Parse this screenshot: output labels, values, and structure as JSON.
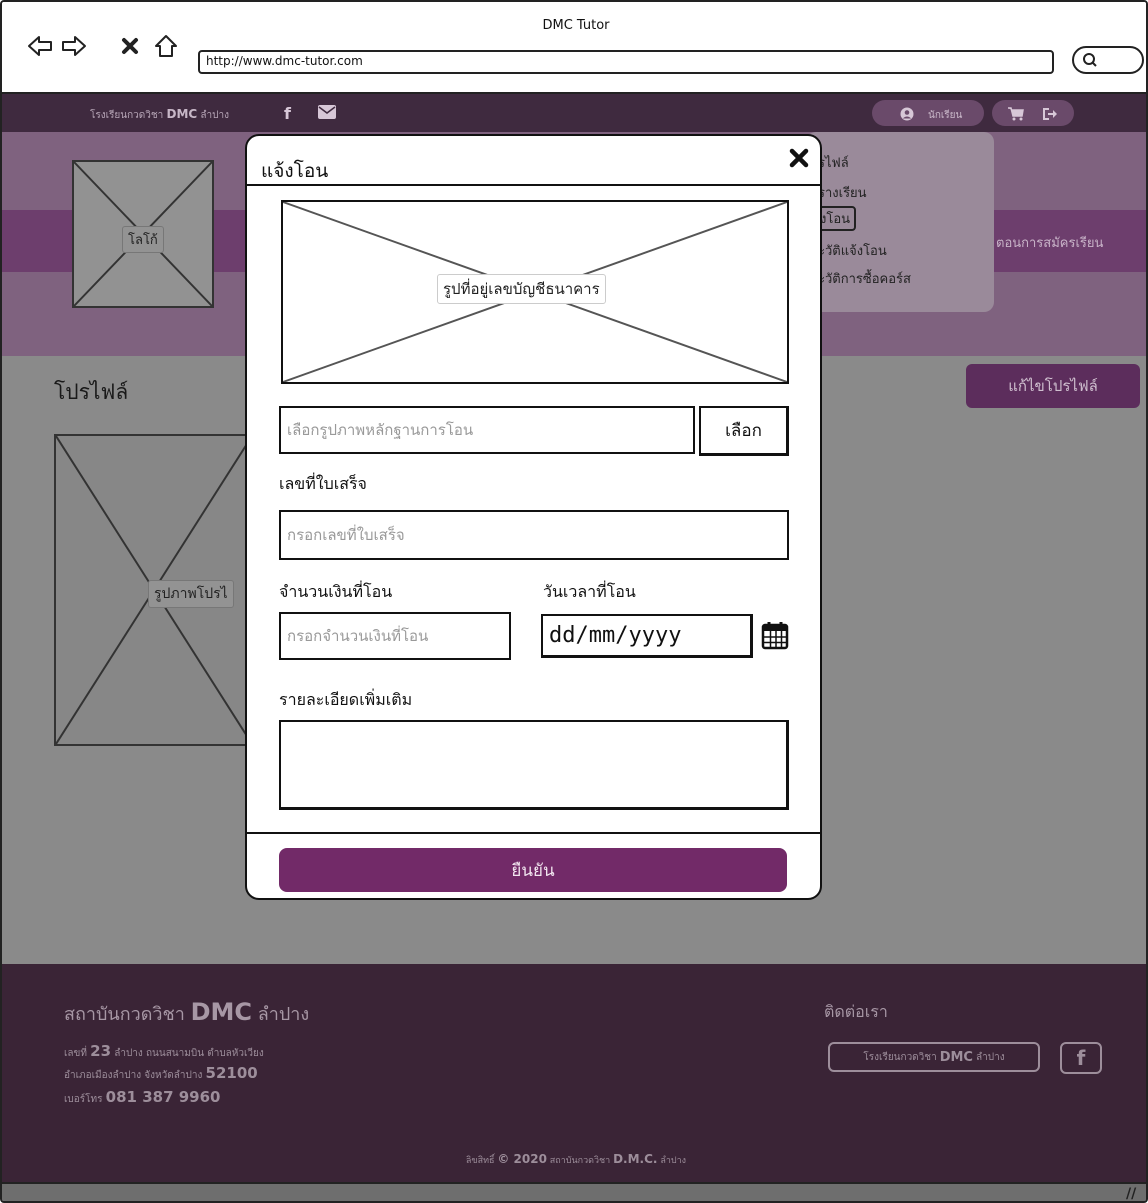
{
  "browser": {
    "window_title": "DMC Tutor",
    "url": "http://www.dmc-tutor.com"
  },
  "topbar": {
    "school_prefix": "โรงเรียนกวดวิชา ",
    "school_brand": "DMC",
    "school_suffix": " ลำปาง",
    "student_label": "นักเรียน"
  },
  "header": {
    "logo_label": "โลโก้"
  },
  "user_menu": {
    "items": [
      "รไฟล์",
      "รางเรียน",
      "งโอน",
      "ะวัติแจ้งโอน",
      "ะวัติการซื้อคอร์ส"
    ]
  },
  "nav": {
    "enroll_label": "ตอนการสมัครเรียน"
  },
  "profile": {
    "title": "โปรไฟล์",
    "edit_button": "แก้ไขโปรไฟล์",
    "photo_label": "รูปภาพโปรไ"
  },
  "modal": {
    "title": "แจ้งโอน",
    "bank_image_label": "รูปที่อยู่เลขบัญชีธนาคาร",
    "file_placeholder": "เลือกรูปภาพหลักฐานการโอน",
    "choose_button": "เลือก",
    "receipt_label": "เลขที่ใบเสร็จ",
    "receipt_placeholder": "กรอกเลขที่ใบเสร็จ",
    "amount_label": "จำนวนเงินที่โอน",
    "amount_placeholder": "กรอกจำนวนเงินที่โอน",
    "datetime_label": "วันเวลาที่โอน",
    "date_value": "dd/mm/yyyy",
    "details_label": "รายละเอียดเพิ่มเติม",
    "submit_button": "ยืนยัน"
  },
  "footer": {
    "title_prefix": "สถาบันกวดวิชา ",
    "title_brand": "DMC",
    "title_suffix": " ลำปาง",
    "addr1_a": "เลขที่ ",
    "addr1_num": "23",
    "addr1_b": " ลำปาง ถนนสนามบิน ตำบลหัวเวียง",
    "addr2_a": "อำเภอเมืองลำปาง จังหวัดลำปาง ",
    "addr2_num": "52100",
    "phone_a": "เบอร์โทร ",
    "phone_num": "081 387 9960",
    "contact_title": "ติดต่อเรา",
    "contact_link_a": "โรงเรียนกวดวิชา",
    "contact_link_brand": "DMC",
    "contact_link_b": "ลำปาง",
    "copy_a": "ลิขสิทธิ์ ",
    "copy_year": "© 2020",
    "copy_b": " สถาบันกวดวิชา ",
    "copy_brand": "D.M.C.",
    "copy_c": " ลำปาง"
  }
}
